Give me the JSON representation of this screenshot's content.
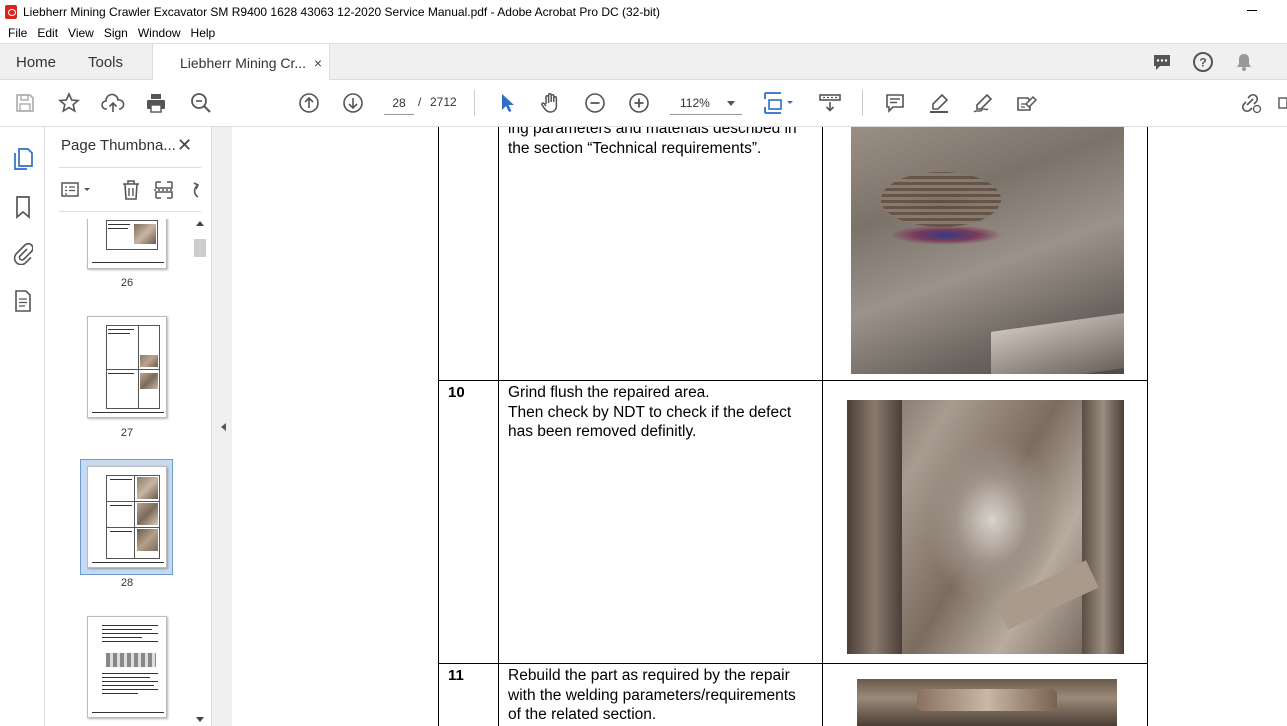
{
  "window": {
    "title": "Liebherr Mining Crawler Excavator SM R9400 1628 43063 12-2020 Service Manual.pdf - Adobe Acrobat Pro DC (32-bit)"
  },
  "menu": [
    "File",
    "Edit",
    "View",
    "Sign",
    "Window",
    "Help"
  ],
  "tabs": {
    "home": "Home",
    "tools": "Tools",
    "document": "Liebherr Mining Cr...",
    "close": "×"
  },
  "toolbar": {
    "current_page": "28",
    "page_separator": "/",
    "total_pages": "2712",
    "zoom": "112%"
  },
  "panel": {
    "title": "Page Thumbna...",
    "close": "✕",
    "thumbnails": [
      {
        "label": "26"
      },
      {
        "label": "27"
      },
      {
        "label": "28"
      },
      {
        "label": ""
      }
    ]
  },
  "document": {
    "rows": [
      {
        "number": "",
        "text": [
          "ing parameters and materials described in",
          "the section “Technical requirements”."
        ]
      },
      {
        "number": "10",
        "text": [
          "Grind flush the repaired area.",
          "Then check by NDT to check if the defect",
          "has been removed definitly."
        ]
      },
      {
        "number": "11",
        "text": [
          "Rebuild the part as required by the repair",
          "with the welding parameters/requirements",
          "of the related section."
        ]
      }
    ]
  },
  "colors": {
    "accent": "#2d6ec9",
    "acrobat_red": "#d9261c"
  }
}
